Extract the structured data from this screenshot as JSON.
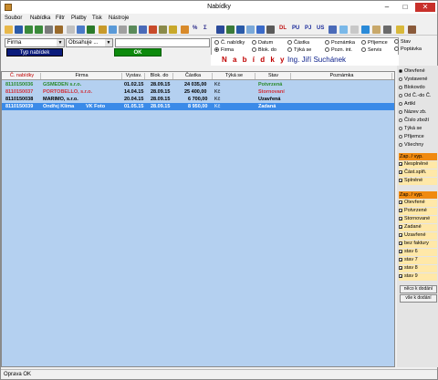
{
  "window": {
    "title": "Nabídky",
    "minimize": "–",
    "maximize": "□",
    "close": "✕"
  },
  "menu": [
    "Soubor",
    "Nabídka",
    "Filtr",
    "Platby",
    "Tisk",
    "Nástroje"
  ],
  "toolbar": {
    "text_buttons": [
      "DL",
      "PU",
      "PJ",
      "US"
    ],
    "sum_label": "Σ",
    "percent_label": "%"
  },
  "filter": {
    "field_select": "Firma",
    "op_select": "Obsahuje ...",
    "value_input": "",
    "type_button": "Typ nabídek",
    "ok_button": "OK"
  },
  "radios": [
    {
      "label": "Č. nabídky",
      "checked": false
    },
    {
      "label": "Datum",
      "checked": false
    },
    {
      "label": "Částka",
      "checked": false
    },
    {
      "label": "Poznámka",
      "checked": false
    },
    {
      "label": "Příjemce",
      "checked": false
    },
    {
      "label": "Stav",
      "checked": false
    },
    {
      "label": "Firma",
      "checked": true
    },
    {
      "label": "Blok. do",
      "checked": false
    },
    {
      "label": "Týká se",
      "checked": false
    },
    {
      "label": "Pozn. int.",
      "checked": false
    },
    {
      "label": "Servis",
      "checked": false
    },
    {
      "label": "Poptávka",
      "checked": false
    }
  ],
  "header_banner": {
    "title": "N a b í d k y",
    "user": "Ing. Jiří Suchánek"
  },
  "grid": {
    "columns": [
      "Č. nabídky",
      "Firma",
      "Vystav.",
      "Blok. do",
      "Částka",
      "Týká se",
      "Stav",
      "Poznámka"
    ],
    "rows": [
      {
        "cislo": "8110150036",
        "firma": "GSMEDEN s.r.o.",
        "vystav": "01.02.15",
        "blok": "28.09.15",
        "castka": "24 035,00",
        "mena": "Kč",
        "tyka": "",
        "stav": "Potvrzená",
        "pozn": "",
        "color": "#2a8a2a"
      },
      {
        "cislo": "8110150037",
        "firma": "PORTOBELLO, s.r.o.",
        "vystav": "14.04.15",
        "blok": "28.09.15",
        "castka": "25 400,00",
        "mena": "Kč",
        "tyka": "",
        "stav": "Stornovaní",
        "pozn": "",
        "color": "#d0303a"
      },
      {
        "cislo": "8110150038",
        "firma": "MARIMO, s.r.o.",
        "vystav": "20.04.15",
        "blok": "28.09.15",
        "castka": "6 700,00",
        "mena": "Kč",
        "tyka": "",
        "stav": "Uzavřená",
        "pozn": "",
        "color": "#000000"
      },
      {
        "cislo": "8110150039",
        "firma": "Ondřej Klíma",
        "firma2": "VK Foto",
        "vystav": "01.05.15",
        "blok": "28.09.15",
        "castka": "8 950,00",
        "mena": "Kč",
        "tyka": "",
        "stav": "Zadaná",
        "pozn": "",
        "color": "#ffffff",
        "selected": true
      }
    ]
  },
  "sidebar": {
    "options": [
      {
        "label": "Otevřené",
        "checked": true
      },
      {
        "label": "Vystavené",
        "checked": false
      },
      {
        "label": "Blokovdo",
        "checked": false
      },
      {
        "label": "Od Č.-do Č.",
        "checked": false
      },
      {
        "label": "Artikl",
        "checked": false
      },
      {
        "label": "Název zb.",
        "checked": false
      },
      {
        "label": "Číslo zboží",
        "checked": false
      },
      {
        "label": "Týká se",
        "checked": false
      },
      {
        "label": "Příjemce",
        "checked": false
      },
      {
        "label": "Všechny",
        "checked": false
      }
    ],
    "group1_header": "Zap. / vyp.",
    "group1": [
      "Nesplněné",
      "Část.splň.",
      "Splněné"
    ],
    "group2_header": "Zap. / vyp.",
    "group2": [
      "Otevřené",
      "Potvrzené",
      "Stornované",
      "Zadané",
      "Uzavřené",
      "bez faktury",
      "stav 6",
      "stav 7",
      "stav 8",
      "stav 9"
    ],
    "btn1": "něco k dodání",
    "btn2": "vše k dodání"
  },
  "status": "Oprava OK"
}
